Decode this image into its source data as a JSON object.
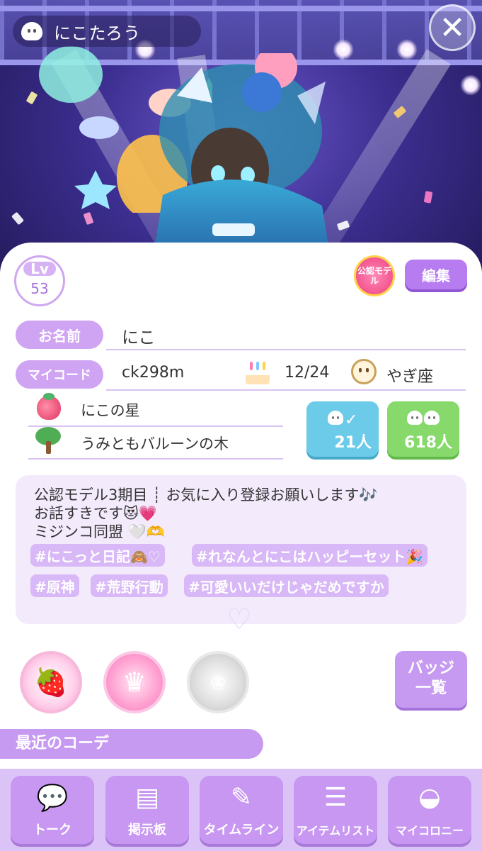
{
  "header": {
    "username": "にこたろう",
    "close_label": "✕"
  },
  "profile": {
    "level_label": "Lv",
    "level_value": "53",
    "official_badge": "公認モデル",
    "edit_label": "編集",
    "name_label": "お名前",
    "name_value": "にこ",
    "mycode_label": "マイコード",
    "mycode_value": "ck298m",
    "birthday": "12/24",
    "zodiac": "やぎ座",
    "planet": "にこの星",
    "tree": "うみともバルーンの木",
    "stats": [
      {
        "value": "21人",
        "color": "#6ccbe8"
      },
      {
        "value": "618人",
        "color": "#86d96a"
      }
    ]
  },
  "bio": {
    "lines": [
      "公認モデル3期目 ┊ お気に入り登録お願いします🎶",
      "お話すきです😻💗",
      "ミジンコ同盟 🤍🫶"
    ],
    "tags": [
      "#にこっと日記🙈♡",
      "#れなんとにこはハッピーセット🎉",
      "#原神",
      "#荒野行動",
      "#可愛いいだけじゃだめですか"
    ]
  },
  "badges": {
    "list_label_1": "バッジ",
    "list_label_2": "一覧"
  },
  "recent_title": "最近のコーデ",
  "nav": [
    {
      "label": "トーク",
      "icon": "chat-bubbles-icon"
    },
    {
      "label": "掲示板",
      "icon": "bulletin-board-icon"
    },
    {
      "label": "タイムライン",
      "icon": "timeline-icon"
    },
    {
      "label": "アイテムリスト",
      "icon": "item-list-icon"
    },
    {
      "label": "マイコロニー",
      "icon": "colony-egg-icon"
    }
  ]
}
